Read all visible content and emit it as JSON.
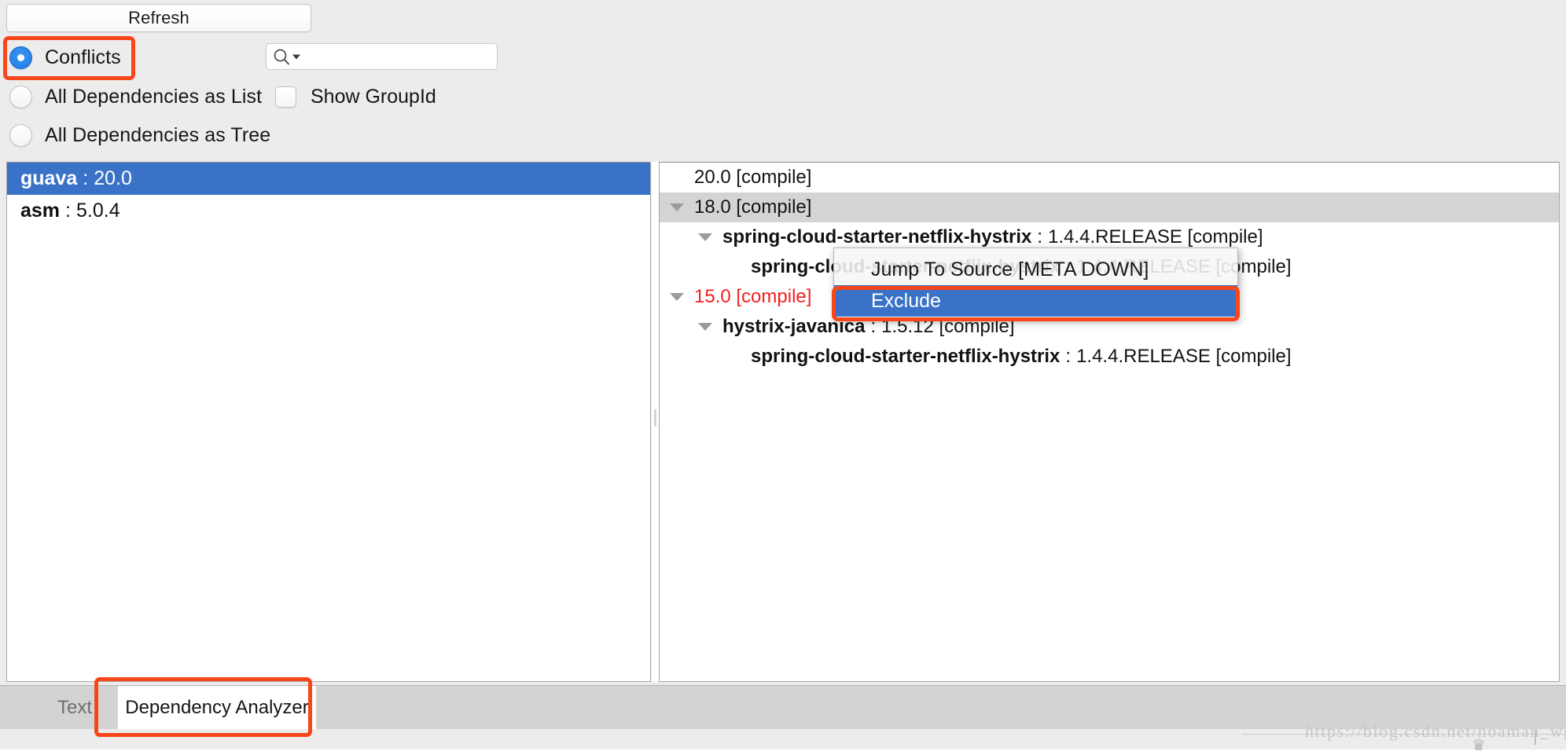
{
  "toolbar": {
    "refresh_label": "Refresh",
    "radios": [
      {
        "label": "Conflicts",
        "selected": true
      },
      {
        "label": "All Dependencies as List",
        "selected": false
      },
      {
        "label": "All Dependencies as Tree",
        "selected": false
      }
    ],
    "search": {
      "value": "",
      "placeholder": "",
      "icon": "search-icon",
      "dropdown_icon": "caret-down-icon"
    },
    "checkbox": {
      "label": "Show GroupId",
      "checked": false
    }
  },
  "conflict_list": {
    "items": [
      {
        "artifact": "guava",
        "separator": ":",
        "version": "20.0",
        "selected": true
      },
      {
        "artifact": "asm",
        "separator": ":",
        "version": "5.0.4",
        "selected": false
      }
    ]
  },
  "dependency_tree": {
    "rows": [
      {
        "indent": 0,
        "twisty": false,
        "expanded": false,
        "artifact": "",
        "separator": "",
        "rest": "20.0 [compile]",
        "red": false,
        "selected": false
      },
      {
        "indent": 0,
        "twisty": true,
        "expanded": true,
        "artifact": "",
        "separator": "",
        "rest": "18.0 [compile]",
        "red": false,
        "selected": true
      },
      {
        "indent": 1,
        "twisty": true,
        "expanded": true,
        "artifact": "spring-cloud-starter-netflix-hystrix",
        "separator": ":",
        "rest": "1.4.4.RELEASE [compile]",
        "red": false,
        "selected": false
      },
      {
        "indent": 2,
        "twisty": false,
        "expanded": false,
        "artifact": "spring-cloud-starter-netflix-hystrix",
        "separator": ":",
        "rest": "1.4.4.RELEASE [compile]",
        "red": false,
        "selected": false
      },
      {
        "indent": 0,
        "twisty": true,
        "expanded": true,
        "artifact": "",
        "separator": "",
        "rest": "15.0 [compile]",
        "red": true,
        "selected": false
      },
      {
        "indent": 1,
        "twisty": true,
        "expanded": true,
        "artifact": "hystrix-javanica",
        "separator": ":",
        "rest": "1.5.12 [compile]",
        "red": false,
        "selected": false
      },
      {
        "indent": 2,
        "twisty": false,
        "expanded": false,
        "artifact": "spring-cloud-starter-netflix-hystrix",
        "separator": ":",
        "rest": "1.4.4.RELEASE [compile]",
        "red": false,
        "selected": false
      }
    ]
  },
  "context_menu": {
    "items": [
      {
        "label": "Jump To Source [META DOWN]",
        "active": false
      },
      {
        "label": "Exclude",
        "active": true
      }
    ]
  },
  "tabs": [
    {
      "label": "Text",
      "active": false
    },
    {
      "label": "Dependency Analyzer",
      "active": true
    }
  ],
  "highlights": {
    "color": "#f8461a",
    "targets": [
      "Conflicts",
      "Exclude",
      "Dependency Analyzer"
    ]
  },
  "watermark": {
    "text": "https://blog.csdn.net/noaman_wgs",
    "crown": "♛"
  }
}
